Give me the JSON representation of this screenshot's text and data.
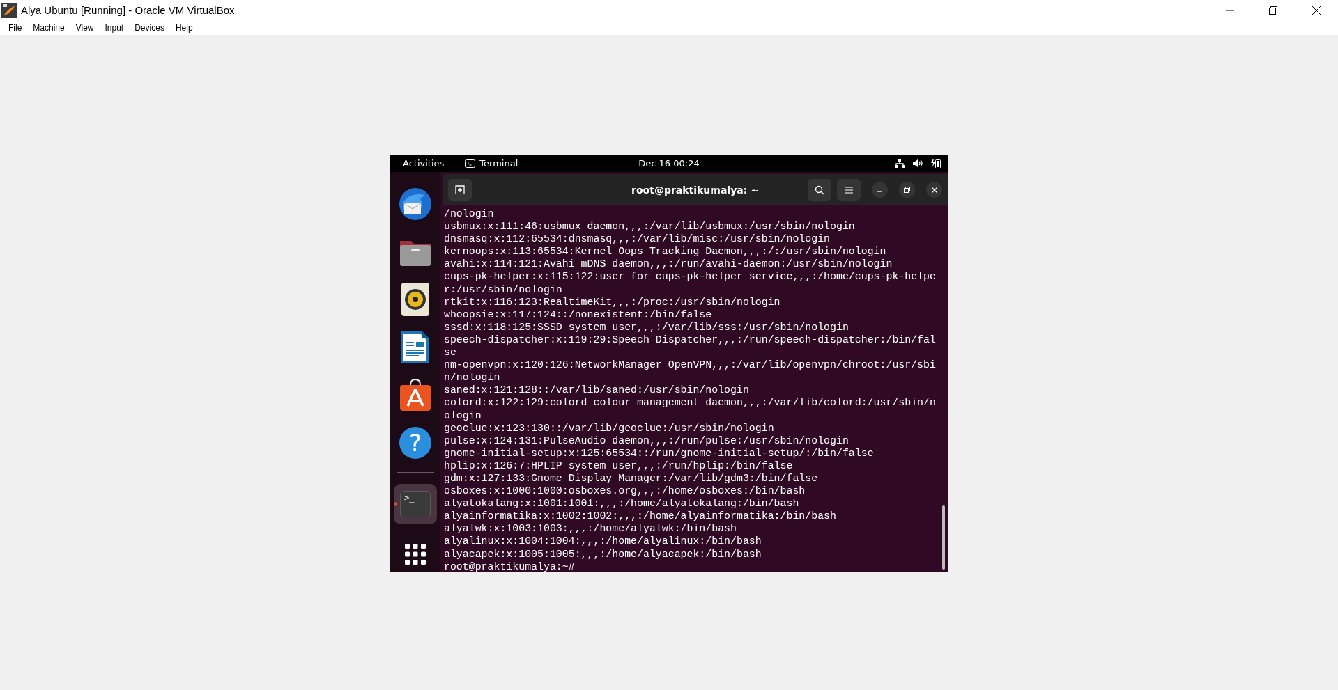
{
  "window": {
    "title": "Alya Ubuntu [Running] - Oracle VM VirtualBox"
  },
  "menu": [
    "File",
    "Machine",
    "View",
    "Input",
    "Devices",
    "Help"
  ],
  "top_bar": {
    "activities": "Activities",
    "app": "Terminal",
    "clock": "Dec 16  00:24"
  },
  "dock": [
    {
      "kind": "mail",
      "selected": false,
      "running": false
    },
    {
      "kind": "files",
      "selected": false,
      "running": false
    },
    {
      "kind": "music",
      "selected": false,
      "running": false
    },
    {
      "kind": "writer",
      "selected": false,
      "running": false
    },
    {
      "kind": "store",
      "selected": false,
      "running": false
    },
    {
      "kind": "help",
      "glyph": "?",
      "selected": false,
      "running": false
    },
    {
      "kind": "separator"
    },
    {
      "kind": "terminal",
      "glyph": ">_",
      "selected": true,
      "running": true
    },
    {
      "kind": "apps",
      "selected": false,
      "running": false
    }
  ],
  "terminal": {
    "title": "root@praktikumalya: ~",
    "lines": [
      "/nologin",
      "usbmux:x:111:46:usbmux daemon,,,:/var/lib/usbmux:/usr/sbin/nologin",
      "dnsmasq:x:112:65534:dnsmasq,,,:/var/lib/misc:/usr/sbin/nologin",
      "kernoops:x:113:65534:Kernel Oops Tracking Daemon,,,:/:/usr/sbin/nologin",
      "avahi:x:114:121:Avahi mDNS daemon,,,:/run/avahi-daemon:/usr/sbin/nologin",
      "cups-pk-helper:x:115:122:user for cups-pk-helper service,,,:/home/cups-pk-helpe",
      "r:/usr/sbin/nologin",
      "rtkit:x:116:123:RealtimeKit,,,:/proc:/usr/sbin/nologin",
      "whoopsie:x:117:124::/nonexistent:/bin/false",
      "sssd:x:118:125:SSSD system user,,,:/var/lib/sss:/usr/sbin/nologin",
      "speech-dispatcher:x:119:29:Speech Dispatcher,,,:/run/speech-dispatcher:/bin/fal",
      "se",
      "nm-openvpn:x:120:126:NetworkManager OpenVPN,,,:/var/lib/openvpn/chroot:/usr/sbi",
      "n/nologin",
      "saned:x:121:128::/var/lib/saned:/usr/sbin/nologin",
      "colord:x:122:129:colord colour management daemon,,,:/var/lib/colord:/usr/sbin/n",
      "ologin",
      "geoclue:x:123:130::/var/lib/geoclue:/usr/sbin/nologin",
      "pulse:x:124:131:PulseAudio daemon,,,:/run/pulse:/usr/sbin/nologin",
      "gnome-initial-setup:x:125:65534::/run/gnome-initial-setup/:/bin/false",
      "hplip:x:126:7:HPLIP system user,,,:/run/hplip:/bin/false",
      "gdm:x:127:133:Gnome Display Manager:/var/lib/gdm3:/bin/false",
      "osboxes:x:1000:1000:osboxes.org,,,:/home/osboxes:/bin/bash",
      "alyatokalang:x:1001:1001:,,,:/home/alyatokalang:/bin/bash",
      "alyainformatika:x:1002:1002:,,,:/home/alyainformatika:/bin/bash",
      "alyalwk:x:1003:1003:,,,:/home/alyalwk:/bin/bash",
      "alyalinux:x:1004:1004:,,,:/home/alyalinux:/bin/bash",
      "alyacapek:x:1005:1005:,,,:/home/alyacapek:/bin/bash",
      "root@praktikumalya:~#"
    ]
  }
}
